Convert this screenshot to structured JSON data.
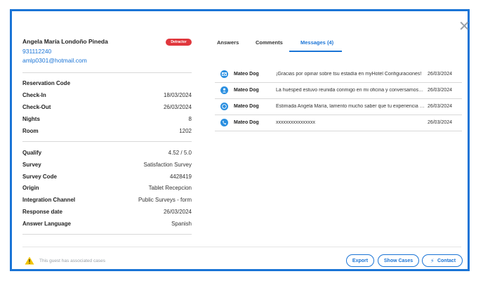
{
  "guest": {
    "name": "Angela María Londoño Pineda",
    "phone": "931112240",
    "email": "amlp0301@hotmail.com",
    "badge": "Detractor"
  },
  "reservation": {
    "heading": "Reservation Code",
    "rows": [
      {
        "label": "Check-In",
        "value": "18/03/2024"
      },
      {
        "label": "Check-Out",
        "value": "26/03/2024"
      },
      {
        "label": "Nights",
        "value": "8"
      },
      {
        "label": "Room",
        "value": "1202"
      }
    ]
  },
  "survey": {
    "rows": [
      {
        "label": "Qualify",
        "value": "4.52 / 5.0"
      },
      {
        "label": "Survey",
        "value": "Satisfaction Survey"
      },
      {
        "label": "Survey Code",
        "value": "4428419"
      },
      {
        "label": "Origin",
        "value": "Tablet Recepcion"
      },
      {
        "label": "Integration Channel",
        "value": "Public Surveys - form"
      },
      {
        "label": "Response date",
        "value": "26/03/2024"
      },
      {
        "label": "Answer Language",
        "value": "Spanish"
      }
    ]
  },
  "tabs": [
    {
      "label": "Answers"
    },
    {
      "label": "Comments"
    },
    {
      "label": "Messages (4)"
    }
  ],
  "messages": [
    {
      "icon": "email-icon",
      "sender": "Mateo Dog",
      "text": "¡Gracias por opinar sobre tsu estadía en myHotel Configuraciones!",
      "date": "26/03/2024"
    },
    {
      "icon": "user-icon",
      "sender": "Mateo Dog",
      "text": "La huésped estuvo reunida conmigo en mi oficina y conversamos mucho",
      "date": "26/03/2024"
    },
    {
      "icon": "whatsapp-icon",
      "sender": "Mateo Dog",
      "text": "Estimada Angela María, lamento mucho saber que tu experiencia en el hotel",
      "date": "26/03/2024"
    },
    {
      "icon": "phone-icon",
      "sender": "Mateo Dog",
      "text": "xxxxxxxxxxxxxxxx",
      "date": "26/03/2024"
    }
  ],
  "footer": {
    "notice": "This guest has associated cases",
    "export_label": "Export",
    "show_cases_label": "Show Cases",
    "contact_label": "Contact"
  },
  "colors": {
    "accent": "#1a74d6",
    "badge": "#e0373d",
    "warning": "#f2c300"
  }
}
